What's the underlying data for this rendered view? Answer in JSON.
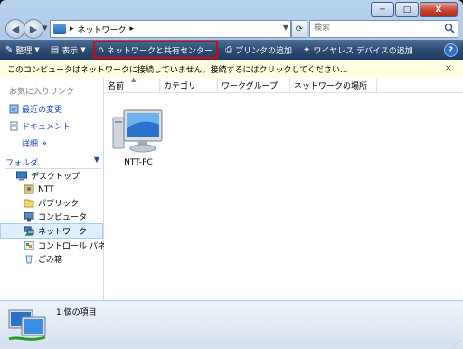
{
  "window": {
    "caption": {
      "minimize": "─",
      "maximize": "□",
      "close": "X"
    }
  },
  "address": {
    "location": "ネットワーク",
    "breadcrumb_sep": "▸",
    "search_placeholder": "検索"
  },
  "toolbar": {
    "organize": "整理",
    "views": "表示",
    "network_center": "ネットワークと共有センター",
    "add_printer": "プリンタの追加",
    "add_wireless": "ワイヤレス デバイスの追加"
  },
  "infobar": {
    "text": "このコンピュータはネットワークに接続していません。接続するにはクリックしてください...",
    "close": "×"
  },
  "sidebar": {
    "favorites_header": "お気に入りリンク",
    "links": [
      "最近の変更",
      "ドキュメント"
    ],
    "more": "詳細",
    "more_arrow": "»",
    "folders_header": "フォルダ",
    "tree": [
      "デスクトップ",
      "NTT",
      "パブリック",
      "コンピュータ",
      "ネットワーク",
      "コントロール パネル",
      "ごみ箱"
    ]
  },
  "columns": [
    "名前",
    "カテゴリ",
    "ワークグループ",
    "ネットワークの場所"
  ],
  "items": [
    {
      "label": "NTT-PC",
      "icon": "computer-icon"
    }
  ],
  "status": {
    "count": "1 個の項目"
  },
  "colors": {
    "highlight": "#e00000",
    "link": "#1d47a8",
    "toolbar": "#2d4d75"
  }
}
